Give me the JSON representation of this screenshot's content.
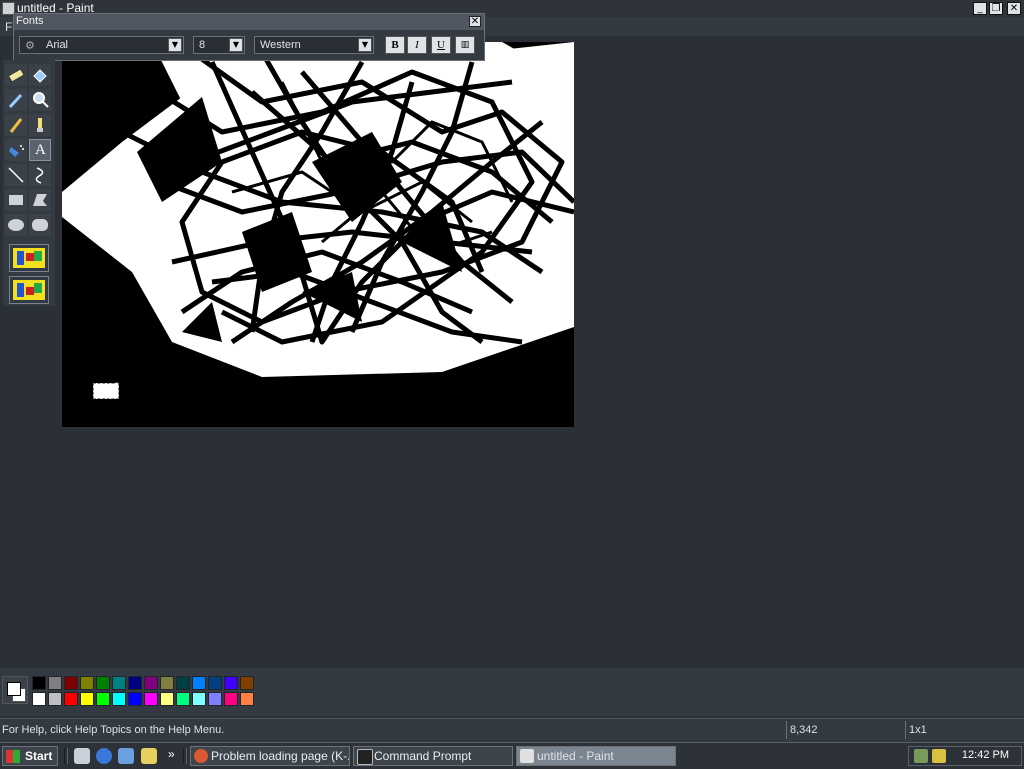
{
  "window": {
    "title": "untitled - Paint",
    "menu_first": "F"
  },
  "fonts_toolbar": {
    "title": "Fonts",
    "font_name": "Arial",
    "font_size": "8",
    "script": "Western",
    "bold": "B",
    "italic": "I",
    "underline": "U"
  },
  "palette_colors": [
    "#000000",
    "#808080",
    "#800000",
    "#808000",
    "#008000",
    "#008080",
    "#000080",
    "#800080",
    "#808040",
    "#004040",
    "#0080ff",
    "#004080",
    "#4000ff",
    "#804000",
    "#ffffff",
    "#c0c0c0",
    "#ff0000",
    "#ffff00",
    "#00ff00",
    "#00ffff",
    "#0000ff",
    "#ff00ff",
    "#ffff80",
    "#00ff80",
    "#80ffff",
    "#8080ff",
    "#ff0080",
    "#ff8040"
  ],
  "status": {
    "help": "For Help, click Help Topics on the Help Menu.",
    "coords": "8,342",
    "size": "1x1"
  },
  "taskbar": {
    "start": "Start",
    "more": "»",
    "tasks": [
      {
        "label": "Problem loading page (K-..."
      },
      {
        "label": "Command Prompt"
      },
      {
        "label": "untitled - Paint"
      }
    ],
    "clock": "12:42 PM"
  },
  "icons": {
    "tools": [
      "free-form-select-icon",
      "select-icon",
      "eraser-icon",
      "fill-icon",
      "color-picker-icon",
      "magnifier-icon",
      "pencil-icon",
      "brush-icon",
      "airbrush-icon",
      "text-icon",
      "line-icon",
      "curve-icon",
      "rectangle-icon",
      "polygon-icon",
      "ellipse-icon",
      "rounded-rectangle-icon"
    ]
  }
}
